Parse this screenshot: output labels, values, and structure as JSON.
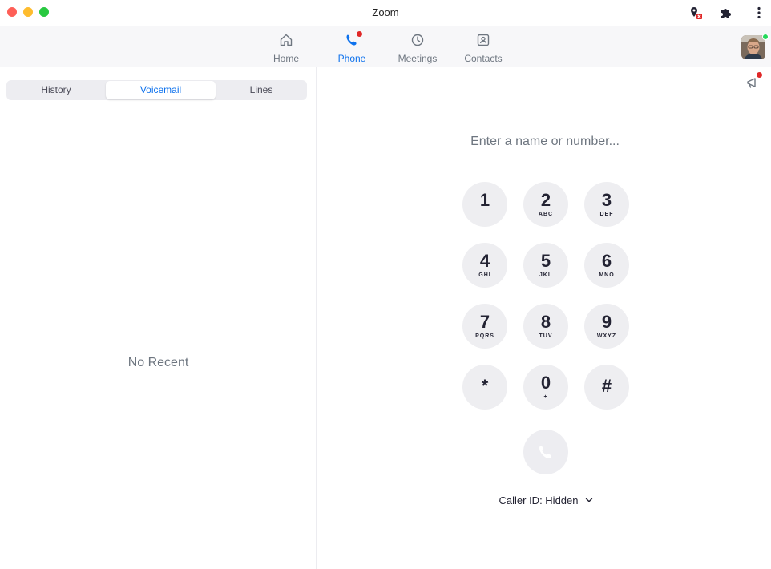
{
  "window": {
    "title": "Zoom"
  },
  "nav": {
    "items": [
      {
        "label": "Home",
        "icon": "home-icon"
      },
      {
        "label": "Phone",
        "icon": "phone-icon",
        "active": true
      },
      {
        "label": "Meetings",
        "icon": "clock-icon"
      },
      {
        "label": "Contacts",
        "icon": "contacts-icon"
      }
    ]
  },
  "left": {
    "tabs": [
      {
        "label": "History"
      },
      {
        "label": "Voicemail",
        "active": true
      },
      {
        "label": "Lines"
      }
    ],
    "empty_text": "No Recent"
  },
  "dialer": {
    "placeholder": "Enter a name or number...",
    "keys": [
      {
        "digit": "1",
        "letters": ""
      },
      {
        "digit": "2",
        "letters": "ABC"
      },
      {
        "digit": "3",
        "letters": "DEF"
      },
      {
        "digit": "4",
        "letters": "GHI"
      },
      {
        "digit": "5",
        "letters": "JKL"
      },
      {
        "digit": "6",
        "letters": "MNO"
      },
      {
        "digit": "7",
        "letters": "PQRS"
      },
      {
        "digit": "8",
        "letters": "TUV"
      },
      {
        "digit": "9",
        "letters": "WXYZ"
      },
      {
        "digit": "*",
        "letters": ""
      },
      {
        "digit": "0",
        "letters": "+"
      },
      {
        "digit": "#",
        "letters": ""
      }
    ],
    "caller_id": "Caller ID: Hidden"
  },
  "colors": {
    "accent": "#0e72ed",
    "notification": "#e02828",
    "online": "#23d959"
  }
}
